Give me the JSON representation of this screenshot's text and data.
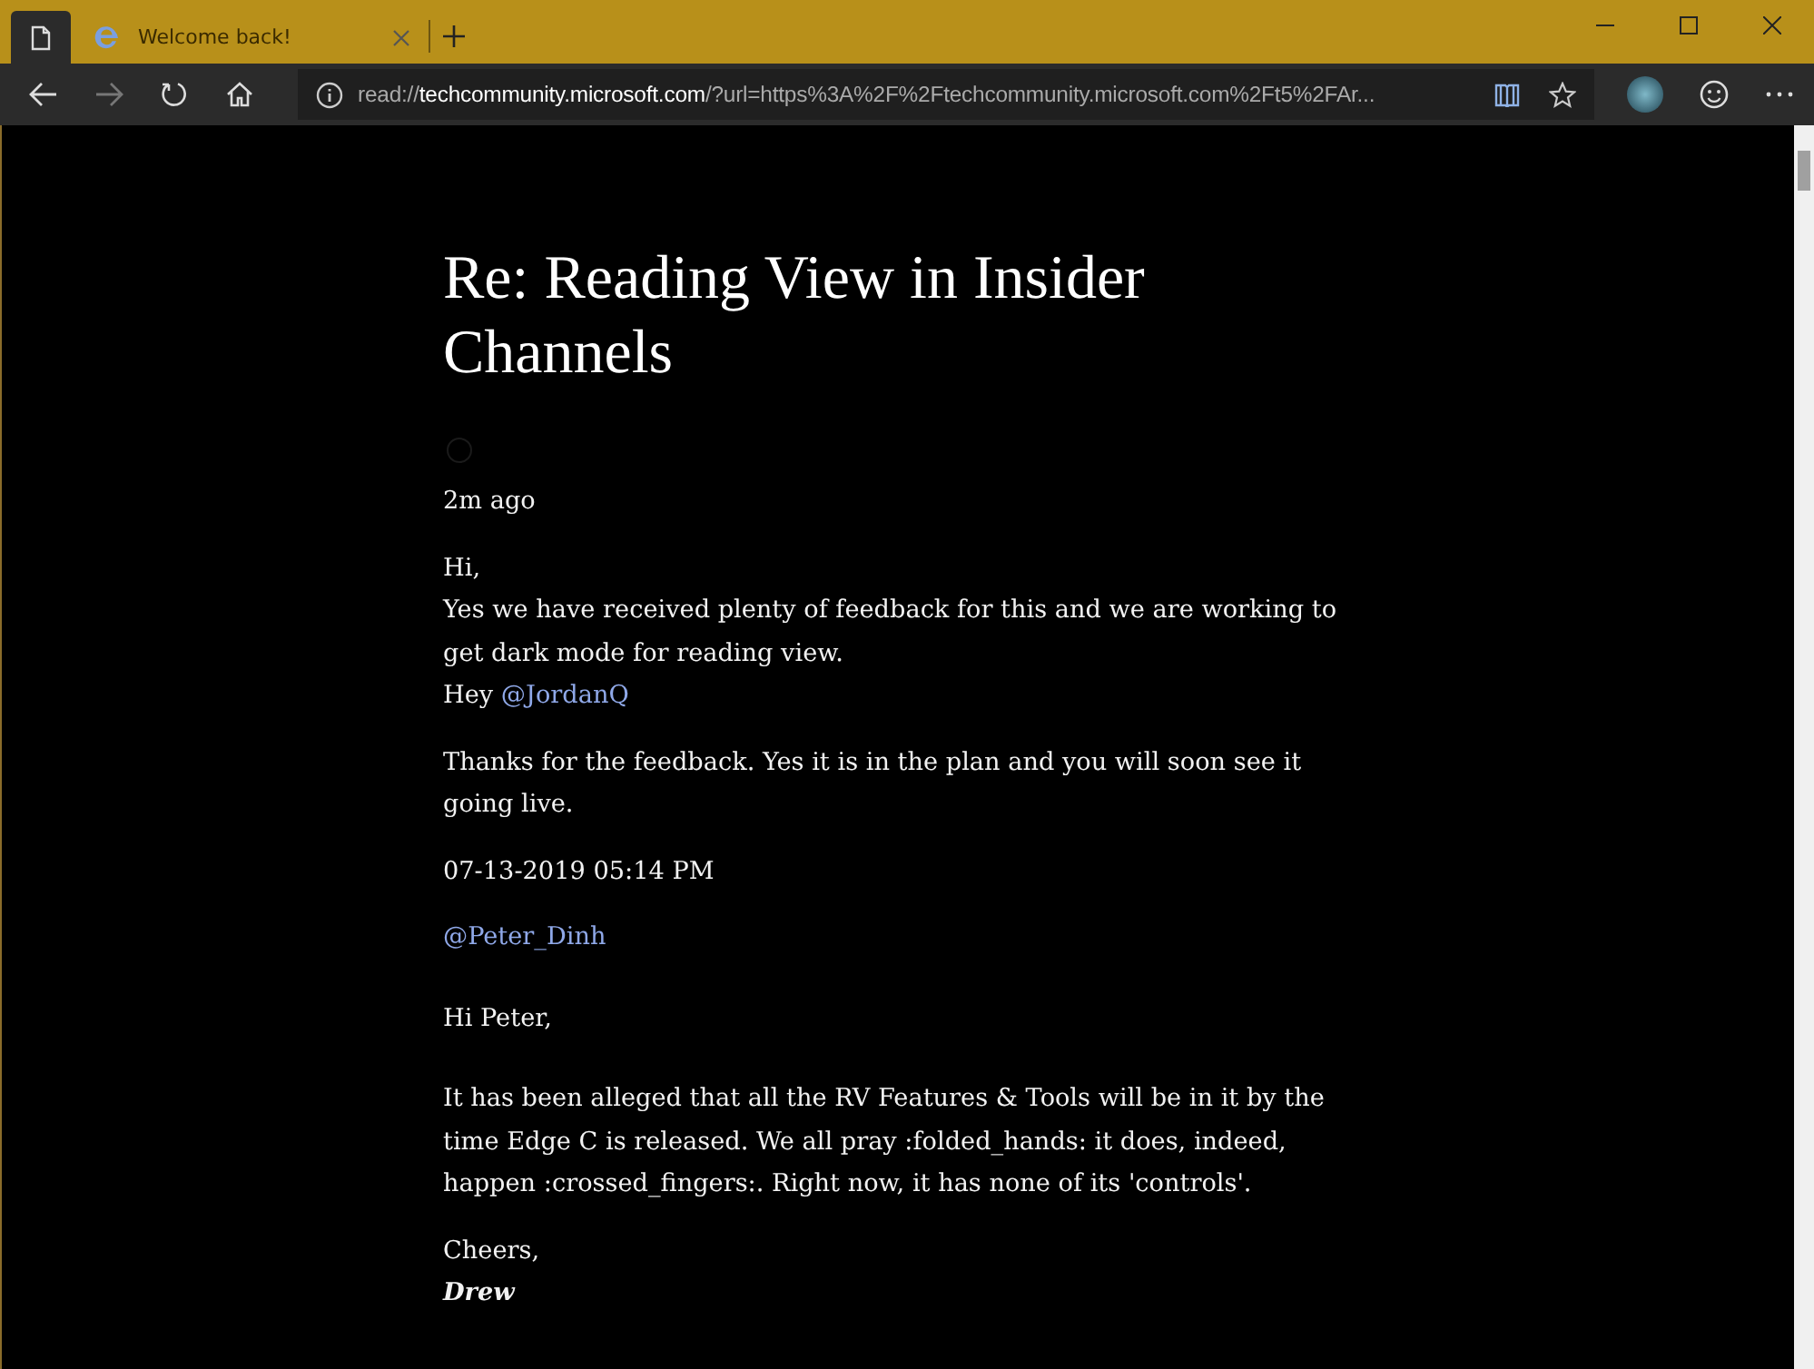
{
  "tabs": [
    {
      "kind": "page",
      "selected": true
    },
    {
      "kind": "site",
      "label": "Welcome back!",
      "selected": false
    }
  ],
  "address_bar": {
    "prefix": "read://",
    "host": "techcommunity.microsoft.com",
    "rest": "/?url=https%3A%2F%2Ftechcommunity.microsoft.com%2Ft5%2FAr..."
  },
  "article": {
    "title": "Re: Reading View in Insider Channels",
    "time": "2m ago",
    "blocks": [
      {
        "kind": "paragraph",
        "lines": [
          {
            "text": "Hi,"
          },
          {
            "text": "Yes we have received plenty of feedback for this and we are working to get dark mode for reading view."
          },
          {
            "text": "Hey ",
            "link": "@JordanQ"
          }
        ]
      },
      {
        "kind": "paragraph",
        "lines": [
          {
            "text": "Thanks for the feedback. Yes it is in the plan and you will soon see it going live."
          }
        ]
      },
      {
        "kind": "paragraph",
        "lines": [
          {
            "text": "07-13-2019 05:14 PM"
          }
        ]
      },
      {
        "kind": "paragraph",
        "lines": [
          {
            "link": "@Peter_Dinh"
          }
        ]
      },
      {
        "kind": "spaced",
        "lines": [
          {
            "text": "Hi Peter,"
          }
        ]
      },
      {
        "kind": "spaced",
        "lines": [
          {
            "text": "It has been alleged that all the RV Features & Tools will be in it by the time Edge C is released.  We all  pray :folded_hands: it does, indeed, happen :crossed_fingers:.  Right now, it has none of its 'controls'."
          }
        ]
      },
      {
        "kind": "paragraph",
        "lines": [
          {
            "text": "Cheers,"
          },
          {
            "text": "Drew",
            "kind": "signature"
          }
        ]
      }
    ]
  }
}
